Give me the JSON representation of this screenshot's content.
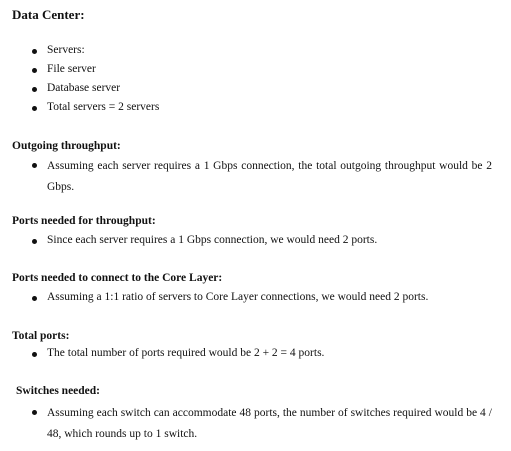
{
  "document": {
    "data_center": {
      "heading": "Data Center:",
      "items": [
        "Servers:",
        "File server",
        "Database server",
        "Total servers = 2 servers"
      ]
    },
    "outgoing_throughput": {
      "heading": "Outgoing throughput:",
      "item": "Assuming each server requires a 1 Gbps connection, the total outgoing throughput would be 2 Gbps."
    },
    "ports_throughput": {
      "heading": "Ports needed for throughput:",
      "item": "Since each server requires a 1 Gbps connection, we would need 2 ports."
    },
    "ports_core": {
      "heading": "Ports needed to connect to the Core Layer:",
      "item": "Assuming a 1:1 ratio of servers to Core Layer connections, we would need 2 ports."
    },
    "total_ports": {
      "heading": "Total ports:",
      "item": "The total number of ports required would be 2 + 2 = 4 ports."
    },
    "switches_needed": {
      "heading": "Switches needed:",
      "item": "Assuming each switch can accommodate 48 ports, the number of switches required would be 4 / 48, which rounds up to 1 switch."
    }
  }
}
